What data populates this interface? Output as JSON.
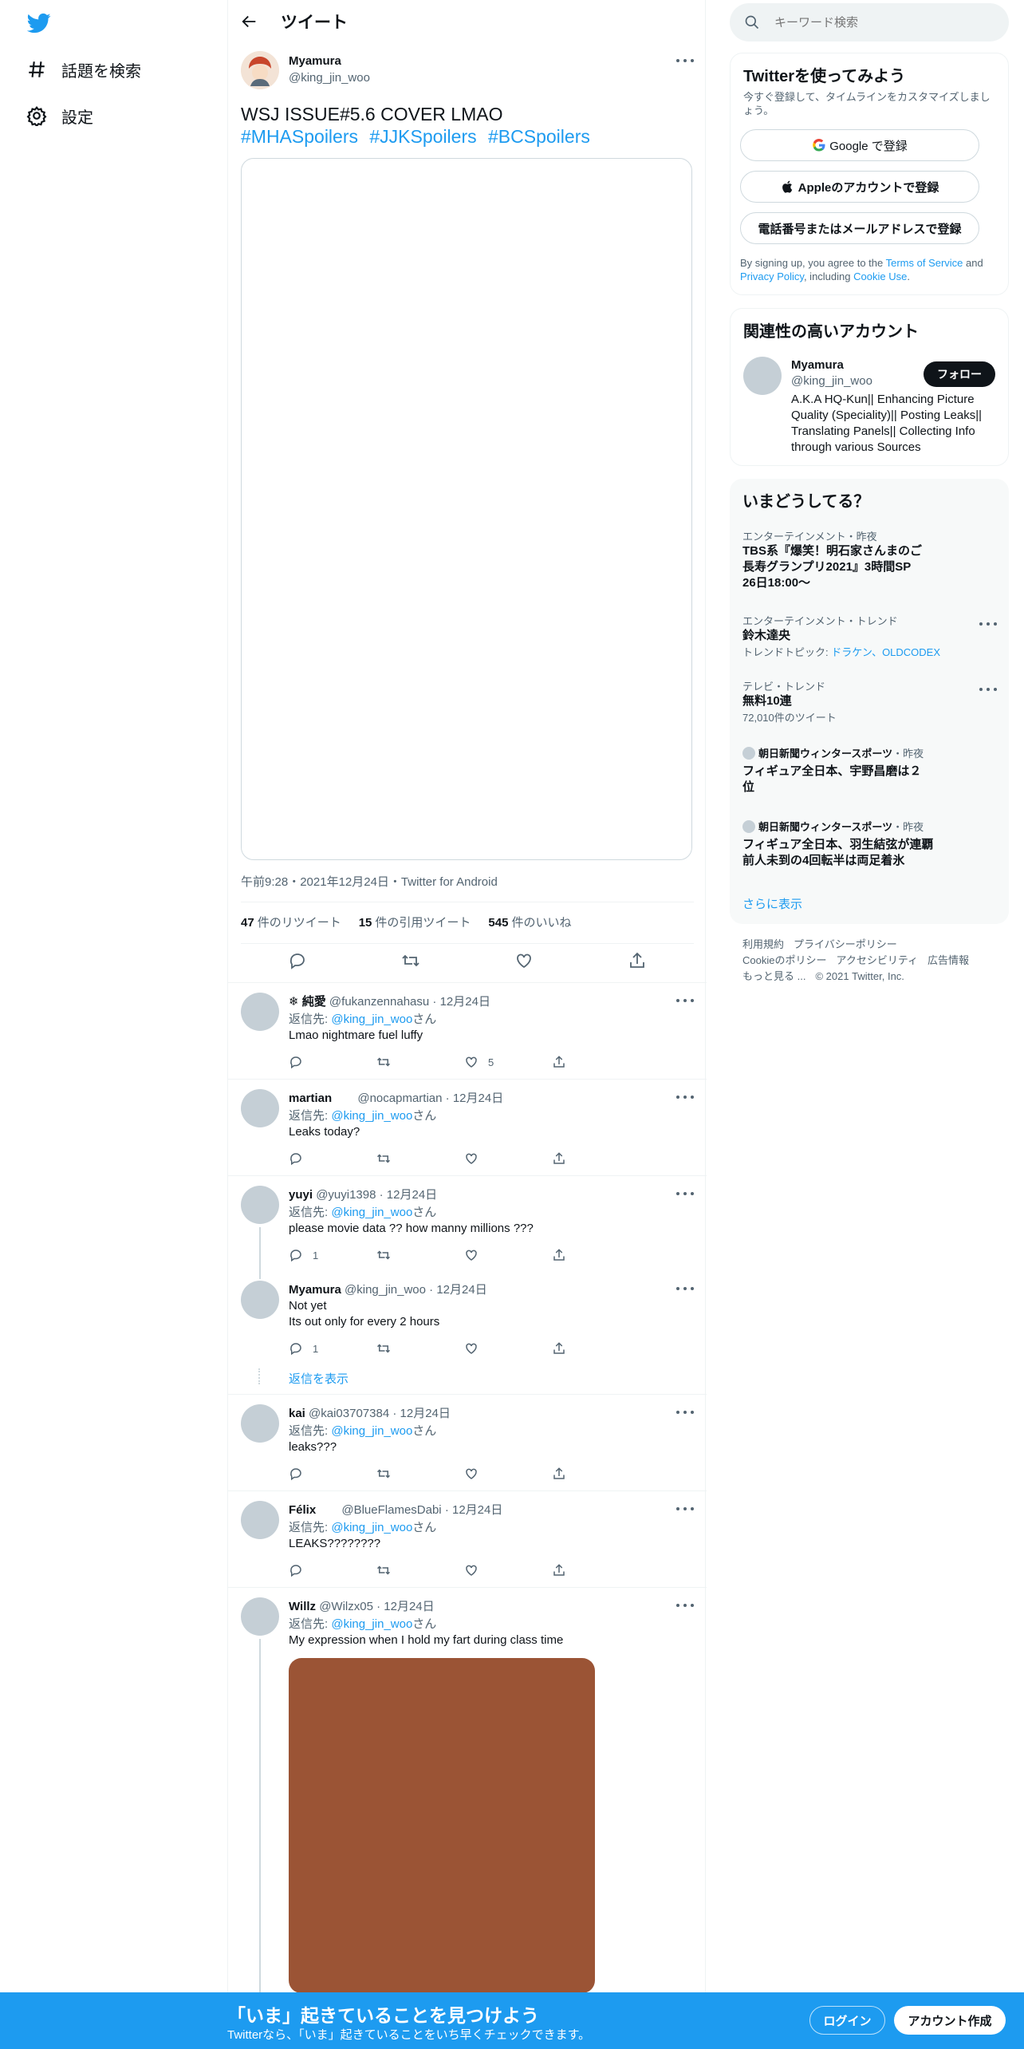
{
  "nav": {
    "explore_label": "話題を検索",
    "settings_label": "設定"
  },
  "header": {
    "title": "ツイート"
  },
  "tweet": {
    "author_name": "Myamura",
    "author_handle": "@king_jin_woo",
    "text": "WSJ ISSUE#5.6 COVER LMAO",
    "hashtags": [
      "#MHASpoilers",
      "#JJKSpoilers",
      "#BCSpoilers"
    ],
    "meta": "午前9:28・2021年12月24日・Twitter for Android",
    "stats": {
      "retweets_count": "47",
      "retweets_label": "件のリツイート",
      "quotes_count": "15",
      "quotes_label": "件の引用ツイート",
      "likes_count": "545",
      "likes_label": "件のいいね"
    }
  },
  "replies": [
    {
      "name": "❄ 純愛",
      "handle": "@fukanzennahasu",
      "date": "· 12月24日",
      "reply_to_prefix": "返信先: ",
      "reply_to": "@king_jin_woo",
      "reply_to_suffix": "さん",
      "text": "Lmao nightmare fuel luffy",
      "reply_count": "",
      "like_count": "5"
    },
    {
      "name": "martian",
      "handle": "@nocapmartian",
      "date": "· 12月24日",
      "reply_to_prefix": "返信先: ",
      "reply_to": "@king_jin_woo",
      "reply_to_suffix": "さん",
      "text": "Leaks today?",
      "reply_count": "",
      "like_count": ""
    },
    {
      "name": "yuyi",
      "handle": "@yuyi1398",
      "date": "· 12月24日",
      "reply_to_prefix": "返信先: ",
      "reply_to": "@king_jin_woo",
      "reply_to_suffix": "さん",
      "text": "please movie data ?? how manny millions ???",
      "reply_count": "1",
      "like_count": ""
    },
    {
      "name": "Myamura",
      "handle": "@king_jin_woo",
      "date": "· 12月24日",
      "text_line1": "Not yet",
      "text_line2": "Its out only for every 2 hours",
      "reply_count": "1",
      "like_count": "",
      "show_replies": "返信を表示"
    },
    {
      "name": "kai",
      "handle": "@kai03707384",
      "date": "· 12月24日",
      "reply_to_prefix": "返信先: ",
      "reply_to": "@king_jin_woo",
      "reply_to_suffix": "さん",
      "text": "leaks???",
      "reply_count": "",
      "like_count": ""
    },
    {
      "name": "Félix",
      "handle": "@BlueFlamesDabi",
      "date": "· 12月24日",
      "reply_to_prefix": "返信先: ",
      "reply_to": "@king_jin_woo",
      "reply_to_suffix": "さん",
      "text": "LEAKS????????",
      "reply_count": "",
      "like_count": ""
    },
    {
      "name": "Willz",
      "handle": "@Wilzx05",
      "date": "· 12月24日",
      "reply_to_prefix": "返信先: ",
      "reply_to": "@king_jin_woo",
      "reply_to_suffix": "さん",
      "text": "My expression when I hold my fart during class time"
    }
  ],
  "sidebar": {
    "search_placeholder": "キーワード検索",
    "signup": {
      "title": "Twitterを使ってみよう",
      "subtitle": "今すぐ登録して、タイムラインをカスタマイズしましょう。",
      "google_btn": "Google で登録",
      "apple_btn": "Appleのアカウントで登録",
      "phone_btn": "電話番号またはメールアドレスで登録",
      "legal_1": "By signing up, you agree to the ",
      "legal_tos": "Terms of Service",
      "legal_2": " and ",
      "legal_pp": "Privacy Policy",
      "legal_3": ", including ",
      "legal_cookie": "Cookie Use",
      "legal_4": "."
    },
    "related": {
      "title": "関連性の高いアカウント",
      "name": "Myamura",
      "handle": "@king_jin_woo",
      "follow_btn": "フォロー",
      "bio": "A.K.A HQ-Kun|| Enhancing Picture Quality (Speciality)|| Posting Leaks|| Translating Panels|| Collecting Info through various Sources"
    },
    "trends": {
      "title": "いまどうしてる？",
      "items": [
        {
          "context": "エンターテインメント・昨夜",
          "title": "TBS系『爆笑！明石家さんまのご長寿グランプリ2021』3時間SP 26日18:00〜"
        },
        {
          "context": "エンターテインメント・トレンド",
          "title": "鈴木達央",
          "sub_prefix": "トレンドトピック: ",
          "sub_links": "ドラケン、OLDCODEX"
        },
        {
          "context": "テレビ・トレンド",
          "title": "無料10連",
          "sub": "72,010件のツイート"
        },
        {
          "source": "朝日新聞ウィンタースポーツ",
          "time": "・昨夜",
          "title": "フィギュア全日本、宇野昌磨は２位"
        },
        {
          "source": "朝日新聞ウィンタースポーツ",
          "time": "・昨夜",
          "title": "フィギュア全日本、羽生結弦が連覇　前人未到の4回転半は両足着氷"
        }
      ],
      "show_more": "さらに表示"
    },
    "footer": {
      "terms": "利用規約",
      "privacy": "プライバシーポリシー",
      "cookie": "Cookieのポリシー",
      "accessibility": "アクセシビリティ",
      "ads": "広告情報",
      "more": "もっと見る ...",
      "copyright": "© 2021 Twitter, Inc."
    }
  },
  "bottom_bar": {
    "title": "「いま」起きていることを見つけよう",
    "subtitle": "Twitterなら、「いま」起きていることをいち早くチェックできます。",
    "login": "ログイン",
    "signup": "アカウント作成"
  },
  "colors": {
    "accent": "#1d9bf0",
    "text": "#0f1419",
    "muted": "#536471",
    "border": "#eff3f4",
    "media_brown": "#9b5435"
  }
}
